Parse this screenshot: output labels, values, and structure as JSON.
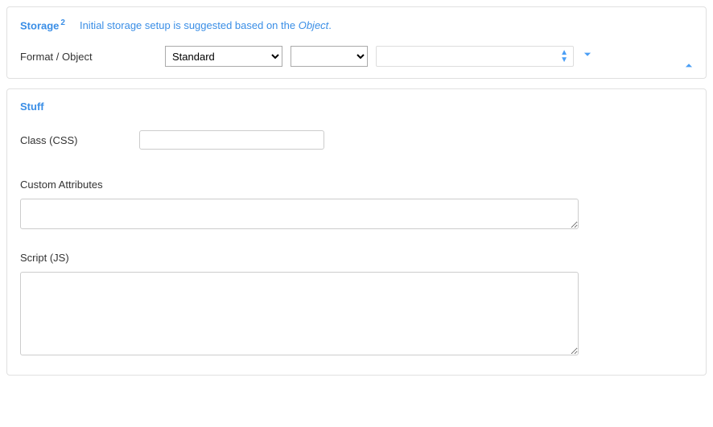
{
  "storage": {
    "title": "Storage",
    "sup": "2",
    "hint_before": "Initial storage setup is suggested based on the ",
    "hint_em": "Object",
    "hint_after": ".",
    "format_object_label": "Format / Object",
    "format_select_value": "Standard",
    "second_select_value": "",
    "combo_value": ""
  },
  "stuff": {
    "title": "Stuff",
    "class_label": "Class (CSS)",
    "class_value": "",
    "custom_attr_label": "Custom Attributes",
    "custom_attr_value": "",
    "script_label": "Script (JS)",
    "script_value": ""
  }
}
